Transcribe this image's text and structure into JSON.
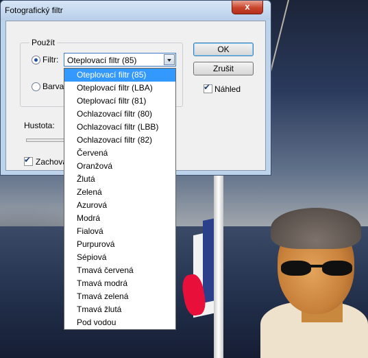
{
  "dialog": {
    "title": "Fotografický filtr",
    "close_label": "x",
    "group_label": "Použít",
    "filter_label": "Filtr:",
    "color_label": "Barva:",
    "selected_filter": "Oteplovací filtr (85)",
    "density_label": "Hustota:",
    "preserve_label": "Zachova",
    "ok_label": "OK",
    "cancel_label": "Zrušit",
    "preview_label": "Náhled"
  },
  "dropdown": {
    "options": [
      "Oteplovací filtr (85)",
      "Oteplovací filtr (LBA)",
      "Oteplovací filtr (81)",
      "Ochlazovací filtr (80)",
      "Ochlazovací filtr (LBB)",
      "Ochlazovací filtr (82)",
      "Červená",
      "Oranžová",
      "Žlutá",
      "Zelená",
      "Azurová",
      "Modrá",
      "Fialová",
      "Purpurová",
      "Sépiová",
      "Tmavá červená",
      "Tmavá modrá",
      "Tmavá zelená",
      "Tmavá žlutá",
      "Pod vodou"
    ],
    "selected_index": 0,
    "highlight_color": "#3399ff"
  }
}
